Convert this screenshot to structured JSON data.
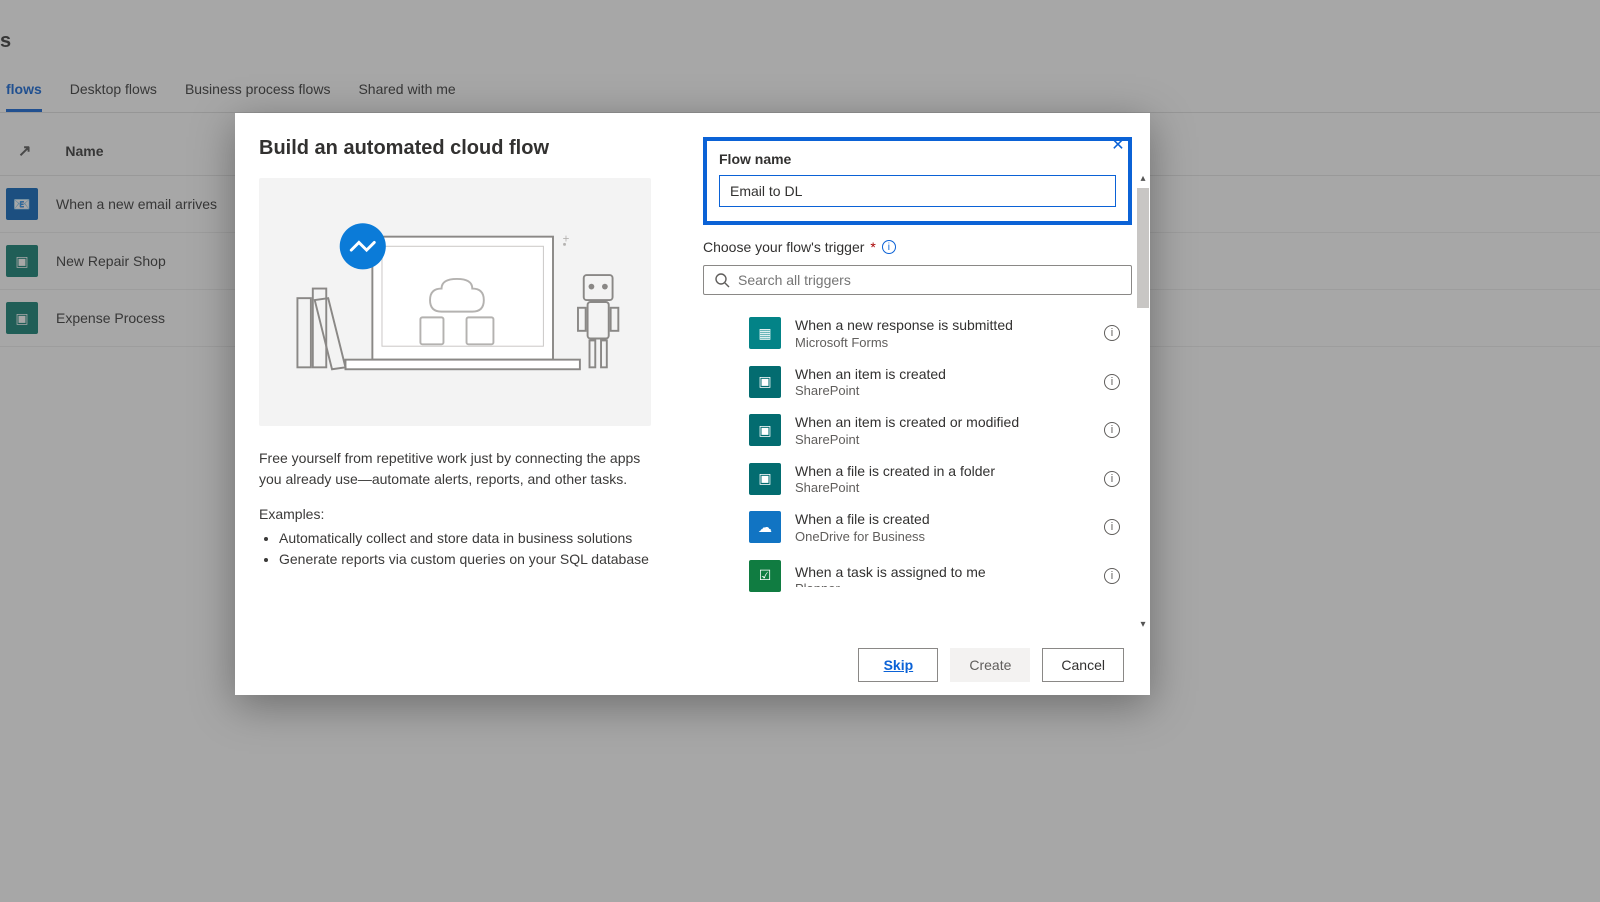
{
  "page": {
    "title_suffix": "s",
    "tabs": [
      "flows",
      "Desktop flows",
      "Business process flows",
      "Shared with me"
    ],
    "list_header_glyph": "↗",
    "list_header": "Name",
    "rows": [
      {
        "name": "When a new email arrives",
        "icon": "outlook"
      },
      {
        "name": "New Repair Shop",
        "icon": "sharepoint"
      },
      {
        "name": "Expense Process",
        "icon": "sharepoint"
      }
    ]
  },
  "modal": {
    "title": "Build an automated cloud flow",
    "flow_name_label": "Flow name",
    "flow_name_value": "Email to DL",
    "choose_trigger": "Choose your flow's trigger",
    "choose_trigger_req": "*",
    "search_placeholder": "Search all triggers",
    "description": "Free yourself from repetitive work just by connecting the apps you already use—automate alerts, reports, and other tasks.",
    "examples_label": "Examples:",
    "examples": [
      "Automatically collect and store data in business solutions",
      "Generate reports via custom queries on your SQL database"
    ],
    "triggers": [
      {
        "title": "When a new response is submitted",
        "source": "Microsoft Forms",
        "icon": "forms"
      },
      {
        "title": "When an item is created",
        "source": "SharePoint",
        "icon": "sp"
      },
      {
        "title": "When an item is created or modified",
        "source": "SharePoint",
        "icon": "sp"
      },
      {
        "title": "When a file is created in a folder",
        "source": "SharePoint",
        "icon": "sp"
      },
      {
        "title": "When a file is created",
        "source": "OneDrive for Business",
        "icon": "od"
      },
      {
        "title": "When a task is assigned to me",
        "source": "Planner",
        "icon": "pl"
      }
    ],
    "footer": {
      "skip": "Skip",
      "create": "Create",
      "cancel": "Cancel"
    }
  }
}
